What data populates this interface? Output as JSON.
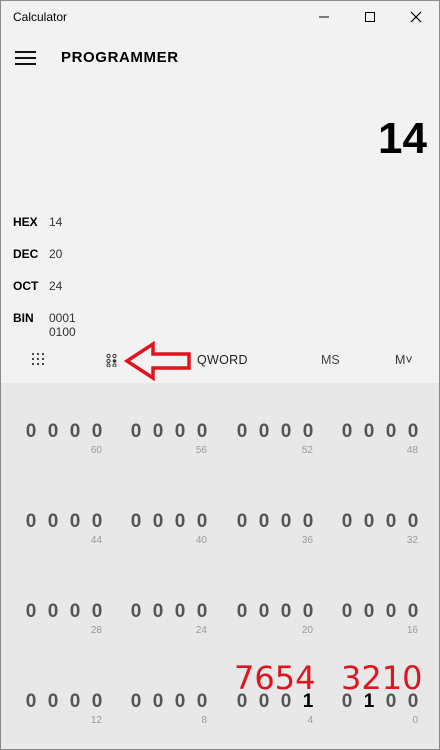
{
  "window": {
    "title": "Calculator"
  },
  "header": {
    "mode_title": "PROGRAMMER"
  },
  "display": {
    "value": "14"
  },
  "radix": [
    {
      "label": "HEX",
      "value": "14"
    },
    {
      "label": "DEC",
      "value": "20"
    },
    {
      "label": "OCT",
      "value": "24"
    },
    {
      "label": "BIN",
      "value": "0001 0100"
    }
  ],
  "toolbar": {
    "word_size": "QWORD",
    "ms": "MS",
    "mplus": "M˅"
  },
  "icons": {
    "full_keypad": "keypad-icon",
    "bit_toggle": "bit-toggle-keypad-icon",
    "annotation_arrow": "red-arrow-annotation",
    "annotation_color": "#e0141e"
  },
  "bits": {
    "rows": [
      [
        {
          "digits": [
            "0",
            "0",
            "0",
            "0"
          ],
          "pos": "60"
        },
        {
          "digits": [
            "0",
            "0",
            "0",
            "0"
          ],
          "pos": "56"
        },
        {
          "digits": [
            "0",
            "0",
            "0",
            "0"
          ],
          "pos": "52"
        },
        {
          "digits": [
            "0",
            "0",
            "0",
            "0"
          ],
          "pos": "48"
        }
      ],
      [
        {
          "digits": [
            "0",
            "0",
            "0",
            "0"
          ],
          "pos": "44"
        },
        {
          "digits": [
            "0",
            "0",
            "0",
            "0"
          ],
          "pos": "40"
        },
        {
          "digits": [
            "0",
            "0",
            "0",
            "0"
          ],
          "pos": "36"
        },
        {
          "digits": [
            "0",
            "0",
            "0",
            "0"
          ],
          "pos": "32"
        }
      ],
      [
        {
          "digits": [
            "0",
            "0",
            "0",
            "0"
          ],
          "pos": "28"
        },
        {
          "digits": [
            "0",
            "0",
            "0",
            "0"
          ],
          "pos": "24"
        },
        {
          "digits": [
            "0",
            "0",
            "0",
            "0"
          ],
          "pos": "20"
        },
        {
          "digits": [
            "0",
            "0",
            "0",
            "0"
          ],
          "pos": "16"
        }
      ],
      [
        {
          "digits": [
            "0",
            "0",
            "0",
            "0"
          ],
          "pos": "12"
        },
        {
          "digits": [
            "0",
            "0",
            "0",
            "0"
          ],
          "pos": "8"
        },
        {
          "digits": [
            "0",
            "0",
            "0",
            "1"
          ],
          "pos": "4"
        },
        {
          "digits": [
            "0",
            "1",
            "0",
            "0"
          ],
          "pos": "0"
        }
      ]
    ]
  },
  "annotations": {
    "left": "7654",
    "right": "3210"
  }
}
